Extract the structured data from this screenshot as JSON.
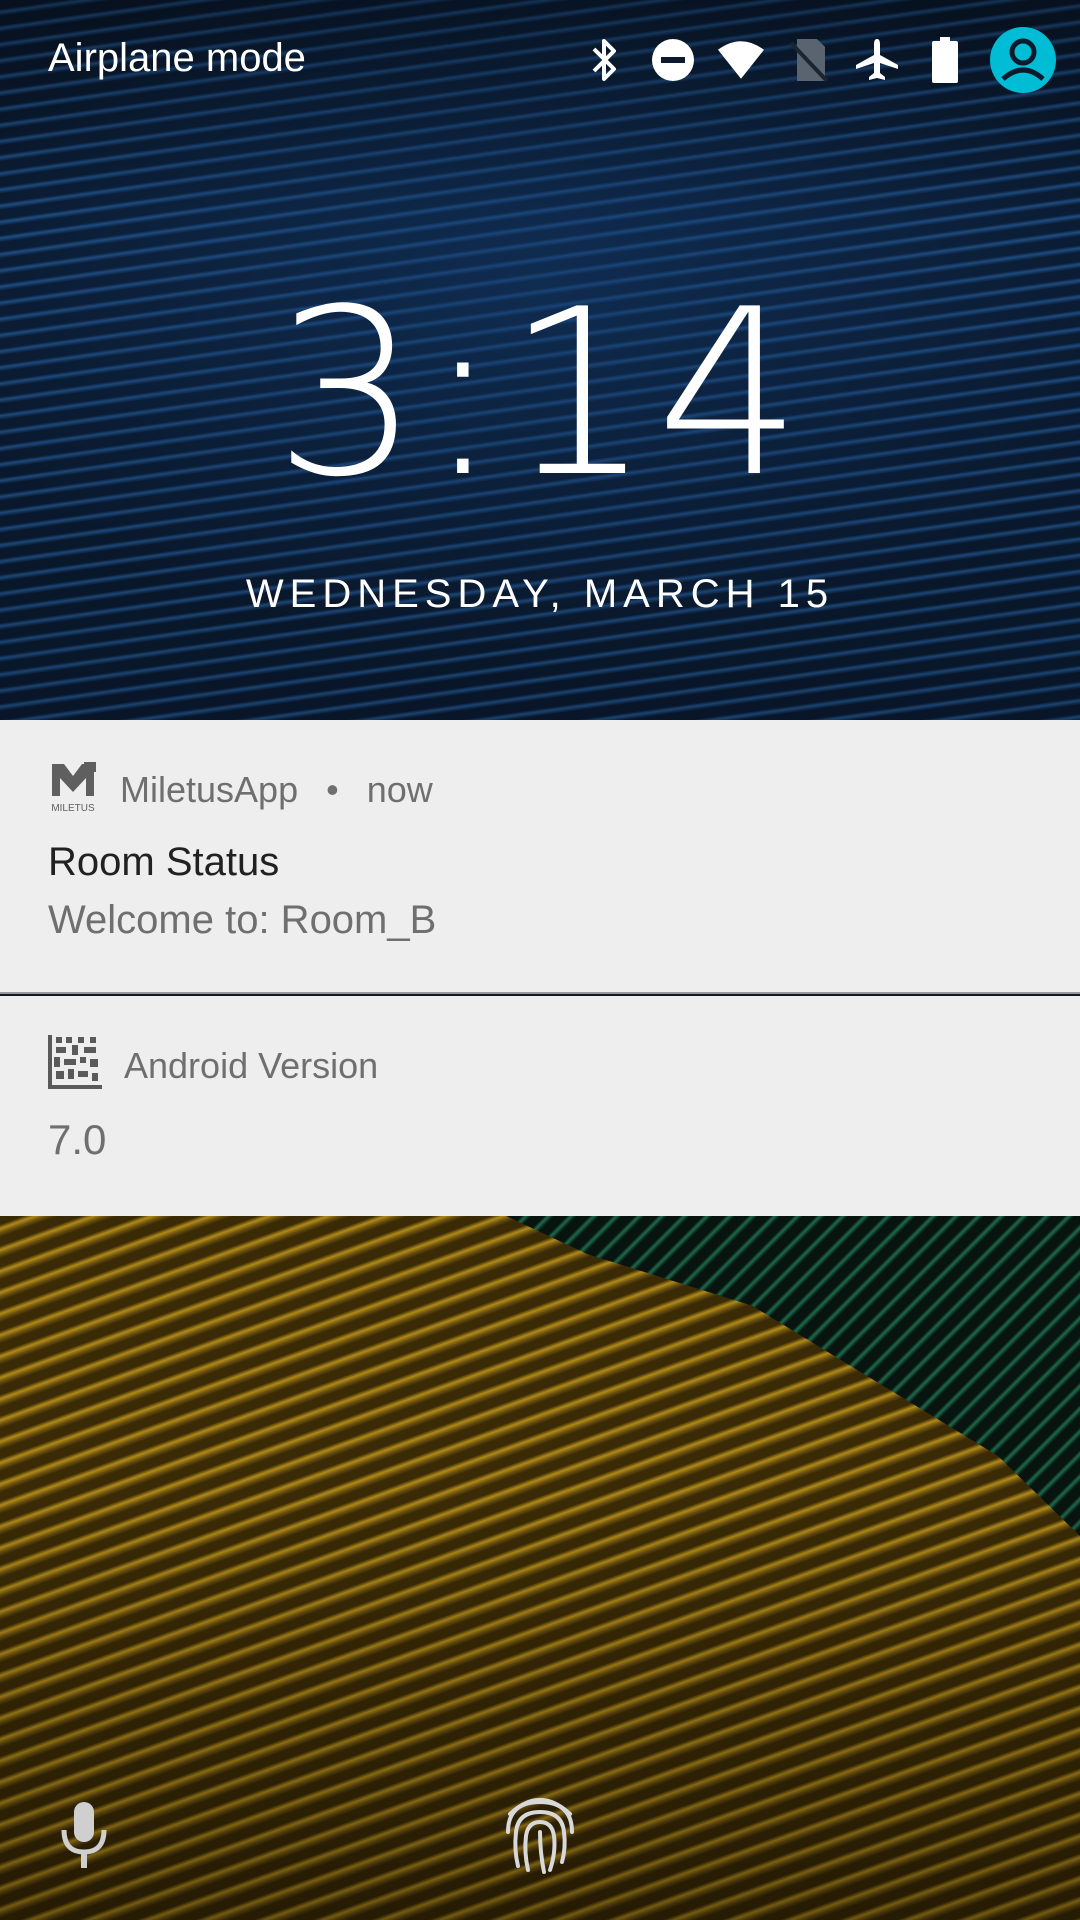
{
  "status_bar": {
    "label": "Airplane mode",
    "icons": [
      "bluetooth-icon",
      "do-not-disturb-icon",
      "wifi-icon",
      "no-sim-icon",
      "airplane-icon",
      "battery-icon",
      "avatar-icon"
    ],
    "accent_color": "#00bcd4"
  },
  "clock": {
    "time": "3:14",
    "date": "WEDNESDAY, MARCH 15"
  },
  "notifications": [
    {
      "app": "MiletusApp",
      "separator": "•",
      "when": "now",
      "title": "Room Status",
      "text": "Welcome to: Room_B",
      "icon": "miletus-logo-icon",
      "logo_text": "MILETUS"
    },
    {
      "app": "Android Version",
      "text": "7.0",
      "icon": "datamatrix-icon"
    }
  ],
  "bottom": {
    "left": "microphone-icon",
    "center": "fingerprint-icon"
  }
}
